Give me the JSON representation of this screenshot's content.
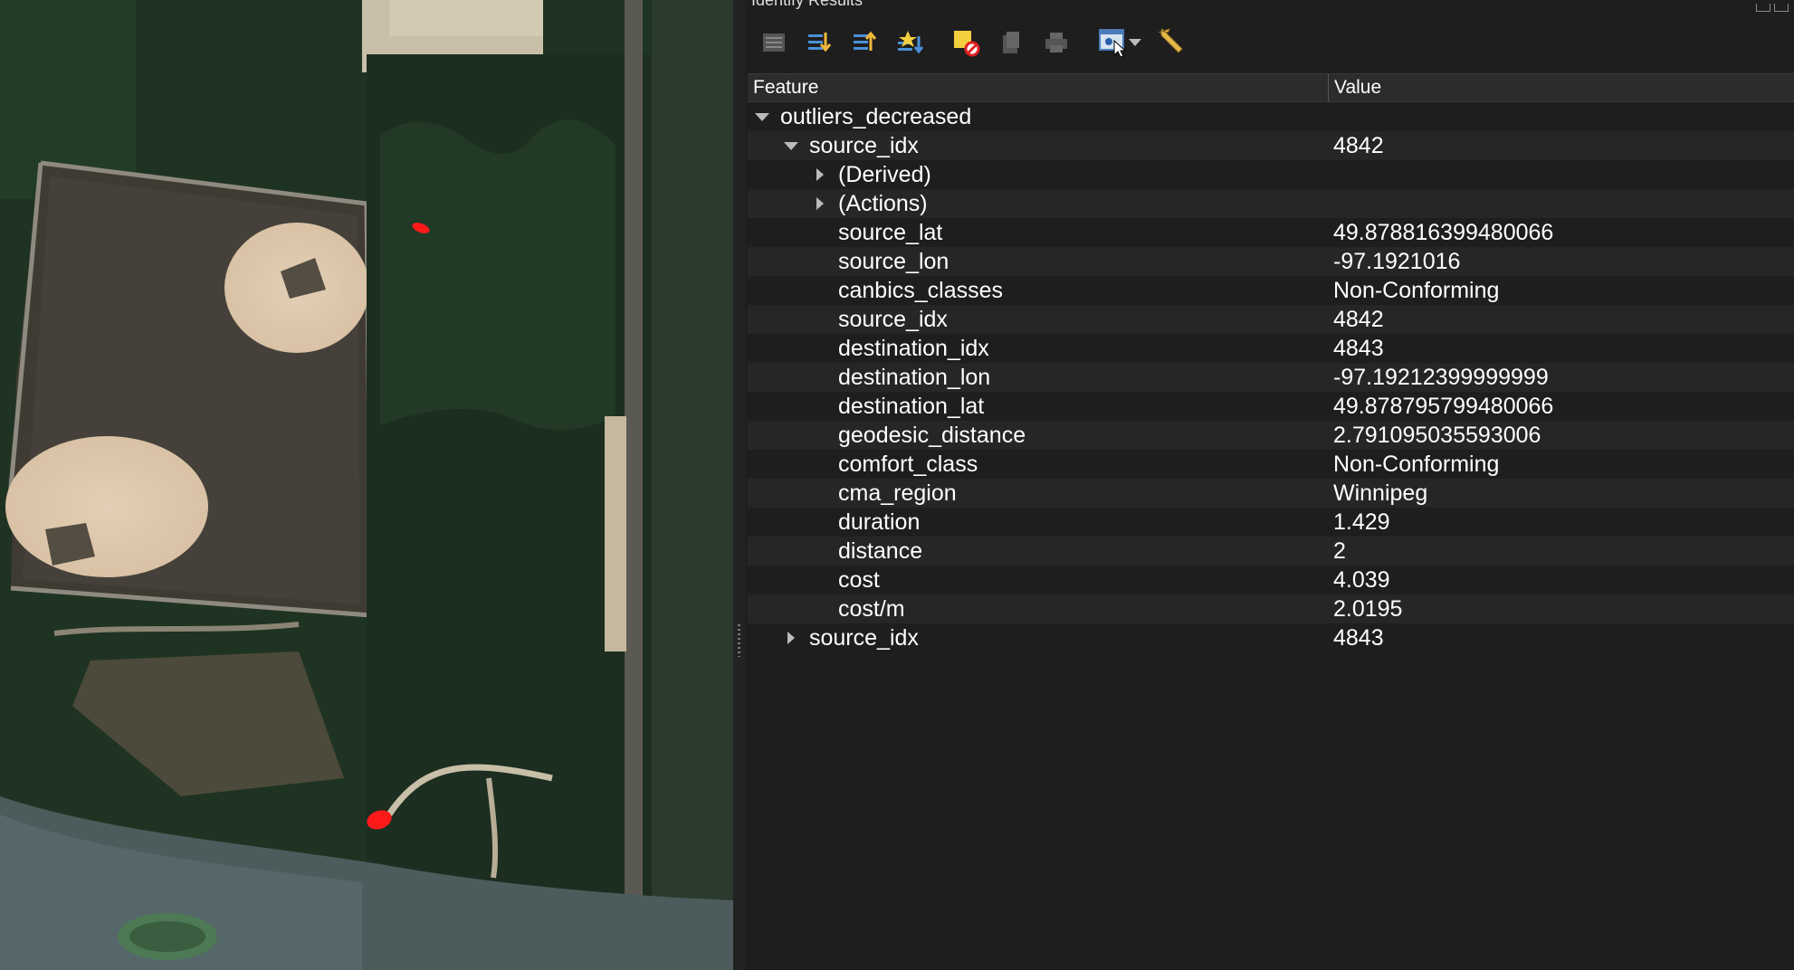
{
  "panel": {
    "title": "Identify Results",
    "toolbar": [
      {
        "name": "expand-tree-icon"
      },
      {
        "name": "expand-all-icon"
      },
      {
        "name": "collapse-all-icon"
      },
      {
        "name": "expand-new-results-icon"
      },
      {
        "name": "clear-results-icon"
      },
      {
        "name": "copy-feature-icon"
      },
      {
        "name": "print-icon"
      },
      {
        "name": "identify-mode-icon"
      },
      {
        "name": "dropdown-arrow-icon"
      },
      {
        "name": "settings-wrench-icon"
      }
    ],
    "columns": {
      "feature": "Feature",
      "value": "Value"
    },
    "layer": "outliers_decreased",
    "feature_1": {
      "label": "source_idx",
      "value": "4842"
    },
    "derived": "(Derived)",
    "actions": "(Actions)",
    "attributes": [
      {
        "name": "source_lat",
        "value": "49.878816399480066"
      },
      {
        "name": "source_lon",
        "value": "-97.1921016"
      },
      {
        "name": "canbics_classes",
        "value": "Non-Conforming"
      },
      {
        "name": "source_idx",
        "value": "4842"
      },
      {
        "name": "destination_idx",
        "value": "4843"
      },
      {
        "name": "destination_lon",
        "value": "-97.19212399999999"
      },
      {
        "name": "destination_lat",
        "value": "49.878795799480066"
      },
      {
        "name": "geodesic_distance",
        "value": "2.791095035593006"
      },
      {
        "name": "comfort_class",
        "value": "Non-Conforming"
      },
      {
        "name": "cma_region",
        "value": "Winnipeg"
      },
      {
        "name": "duration",
        "value": "1.429"
      },
      {
        "name": "distance",
        "value": "2"
      },
      {
        "name": "cost",
        "value": "4.039"
      },
      {
        "name": "cost/m",
        "value": "2.0195"
      }
    ],
    "feature_2": {
      "label": "source_idx",
      "value": "4843"
    }
  },
  "colors": {
    "panel_bg": "#1e1e1e",
    "row_alt": "#262626",
    "outlier_marker": "#ff1a1a"
  }
}
